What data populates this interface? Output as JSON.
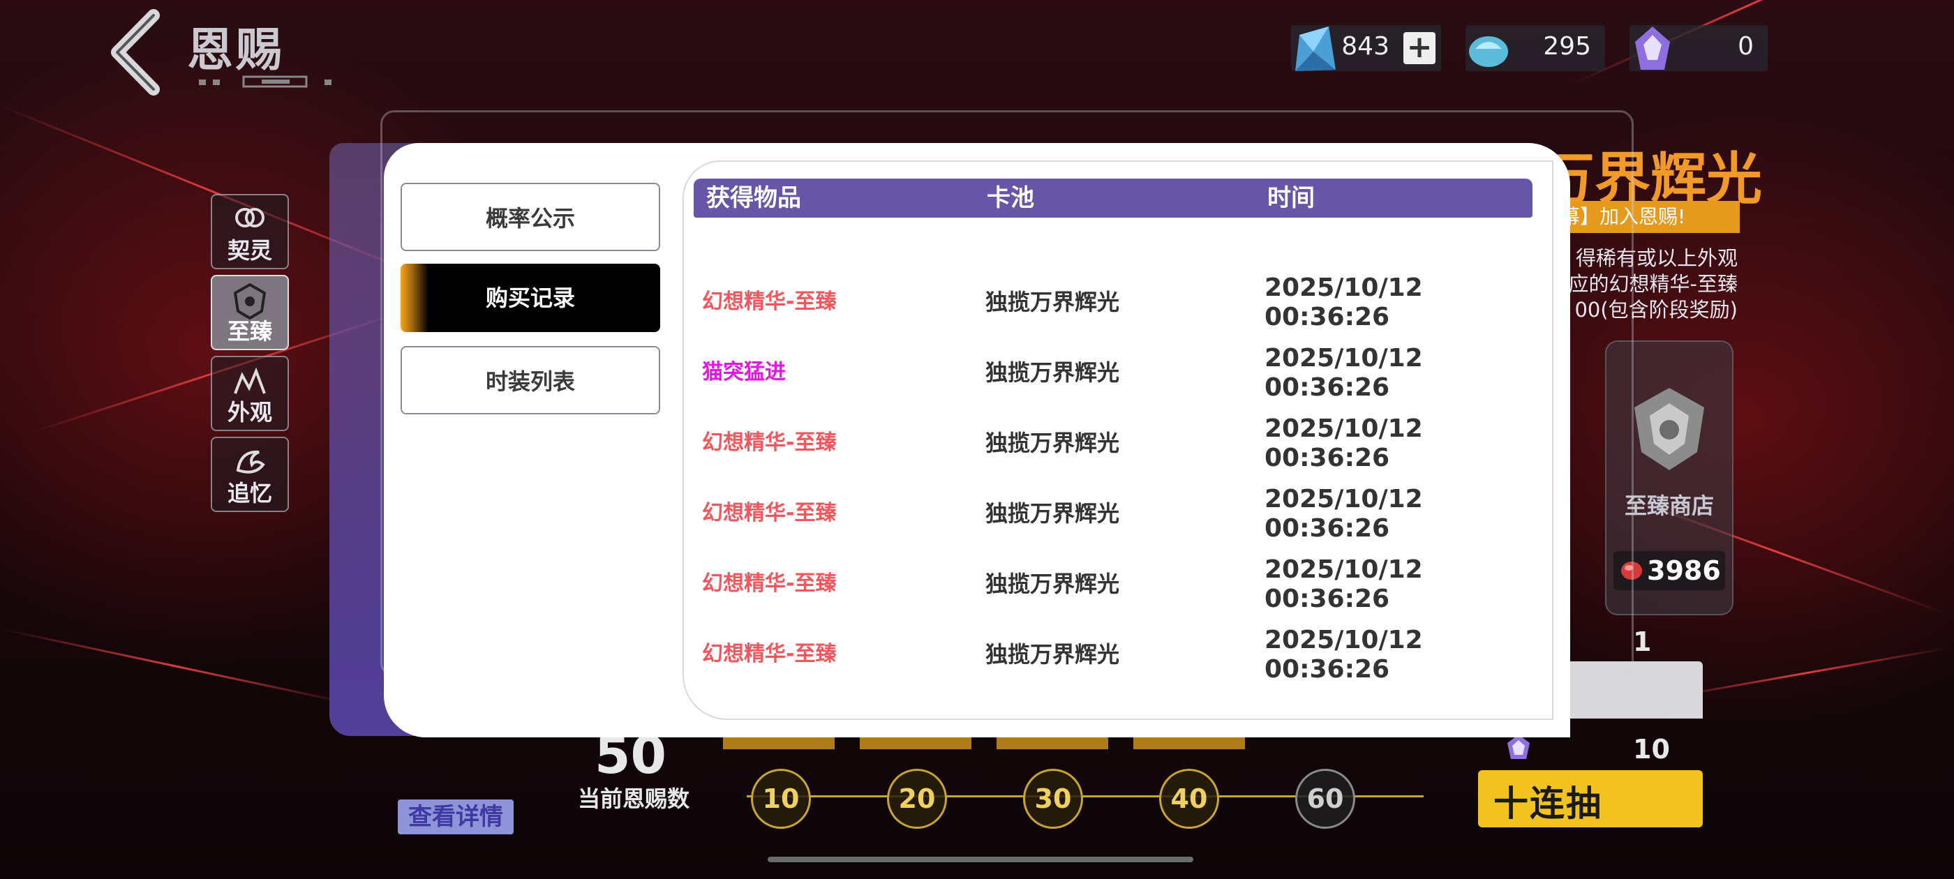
{
  "header": {
    "title": "恩赐",
    "currencies": [
      {
        "icon": "crystal-icon",
        "value": "843"
      },
      {
        "icon": "blue-gem-icon",
        "value": "295"
      },
      {
        "icon": "purple-token-icon",
        "value": "0"
      }
    ]
  },
  "categories": [
    {
      "label": "契灵",
      "icon": "spirit-icon"
    },
    {
      "label": "至臻",
      "icon": "emblem-icon"
    },
    {
      "label": "外观",
      "icon": "outfit-icon"
    },
    {
      "label": "追忆",
      "icon": "memory-icon"
    }
  ],
  "modal": {
    "tabs": [
      "概率公示",
      "购买记录",
      "时装列表"
    ],
    "active_tab": "购买记录",
    "columns": [
      "获得物品",
      "卡池",
      "时间"
    ],
    "rows": [
      {
        "item": "幻想精华-至臻",
        "pool": "独揽万界辉光",
        "date": "2025/10/12",
        "time": "00:36:26",
        "color": "#f2575e"
      },
      {
        "item": "猫突猛进",
        "pool": "独揽万界辉光",
        "date": "2025/10/12",
        "time": "00:36:26",
        "color": "#e316e6"
      },
      {
        "item": "幻想精华-至臻",
        "pool": "独揽万界辉光",
        "date": "2025/10/12",
        "time": "00:36:26",
        "color": "#f2575e"
      },
      {
        "item": "幻想精华-至臻",
        "pool": "独揽万界辉光",
        "date": "2025/10/12",
        "time": "00:36:26",
        "color": "#f2575e"
      },
      {
        "item": "幻想精华-至臻",
        "pool": "独揽万界辉光",
        "date": "2025/10/12",
        "time": "00:36:26",
        "color": "#f2575e"
      },
      {
        "item": "幻想精华-至臻",
        "pool": "独揽万界辉光",
        "date": "2025/10/12",
        "time": "00:36:26",
        "color": "#f2575e"
      }
    ]
  },
  "banner": {
    "title": "万界辉光",
    "subtitle": "帷幕】加入恩赐!",
    "desc_lines": [
      "得稀有或以上外观",
      "应的幻想精华-至臻",
      "00(包含阶段奖励)"
    ]
  },
  "shop": {
    "label": "至臻商店",
    "price": "3986"
  },
  "draw": {
    "single_count": "1",
    "ten_count": "10",
    "ten_label": "十连抽"
  },
  "progress": {
    "current": "50",
    "current_label": "当前恩赐数",
    "milestones": [
      "10",
      "20",
      "30",
      "40",
      "60"
    ]
  },
  "detail_button": "查看详情"
}
